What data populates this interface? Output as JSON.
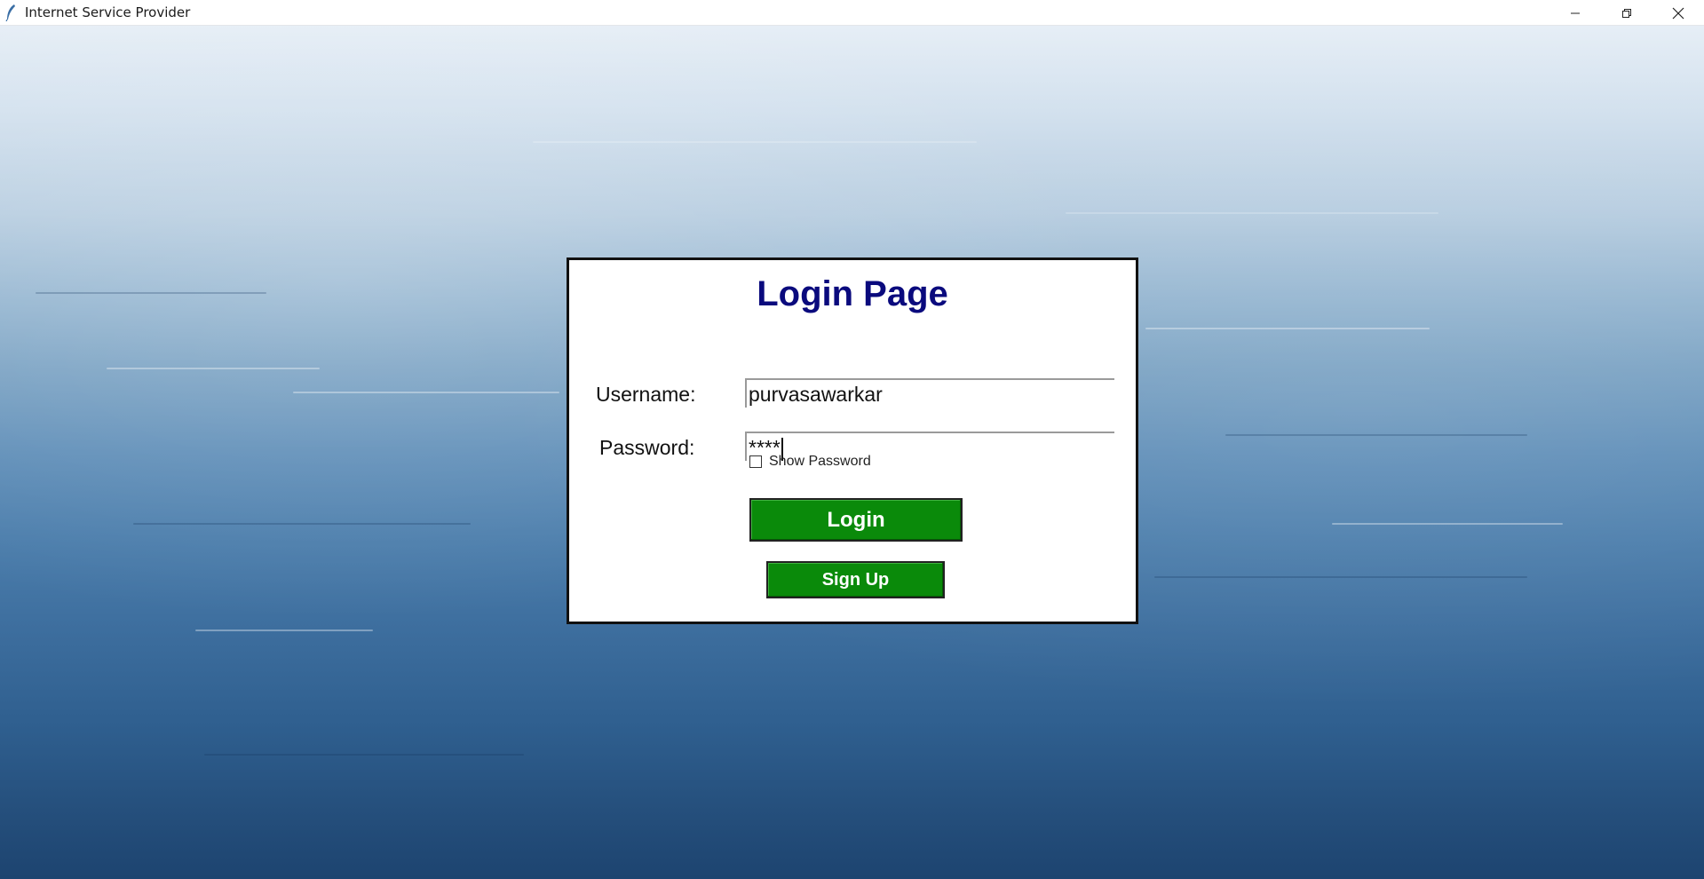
{
  "window": {
    "title": "Internet Service Provider",
    "icons": {
      "app": "feather-icon",
      "minimize": "minimize-icon",
      "restore": "restore-icon",
      "close": "close-icon"
    }
  },
  "login": {
    "title": "Login Page",
    "username_label": "Username:",
    "username_value": "purvasawarkar",
    "password_label": "Password:",
    "password_value": "****",
    "show_password_label": "Show Password",
    "show_password_checked": false,
    "login_button": "Login",
    "signup_button": "Sign Up"
  },
  "colors": {
    "title": "#0a0a7d",
    "button": "#0a8a0a",
    "button_text": "#ffffff"
  }
}
